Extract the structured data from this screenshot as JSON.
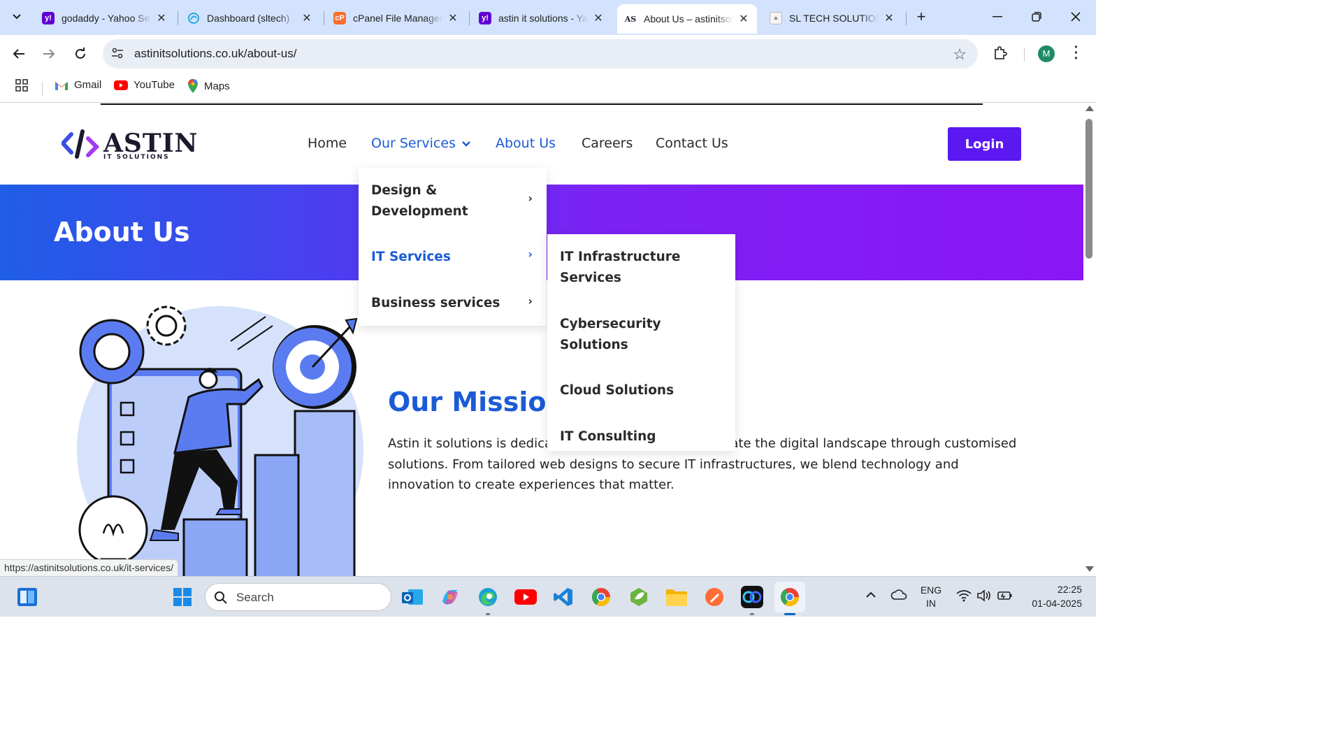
{
  "browser": {
    "tabs": [
      {
        "title": "godaddy - Yahoo Search",
        "favicon": "yahoo-icon",
        "color": "#6001d2",
        "glyph": "y!"
      },
      {
        "title": "Dashboard (sltech)",
        "favicon": "dashboard-icon",
        "color": "#29a8e0",
        "glyph": ""
      },
      {
        "title": "cPanel File Manager",
        "favicon": "cpanel-icon",
        "color": "#ff6c2c",
        "glyph": "cP"
      },
      {
        "title": "astin it solutions - Yahoo",
        "favicon": "yahoo-icon",
        "color": "#6001d2",
        "glyph": "y!"
      },
      {
        "title": "About Us – astinitsolutions",
        "favicon": "astin-icon",
        "color": "#1a1a2e",
        "glyph": "AS"
      },
      {
        "title": "SL TECH SOLUTIONS",
        "favicon": "sltech-icon",
        "color": "#888888",
        "glyph": ""
      }
    ],
    "active_tab": 4,
    "url": "astinitsolutions.co.uk/about-us/",
    "profile_initial": "M",
    "bookmarks": [
      {
        "label": "Gmail"
      },
      {
        "label": "YouTube"
      },
      {
        "label": "Maps"
      }
    ],
    "status_url": "https://astinitsolutions.co.uk/it-services/"
  },
  "site": {
    "logo": {
      "name": "ASTIN",
      "tagline": "IT SOLUTIONS"
    },
    "nav": {
      "home": "Home",
      "services": "Our Services",
      "about": "About Us",
      "careers": "Careers",
      "contact": "Contact Us"
    },
    "login": "Login",
    "hero_title": "About Us",
    "services_menu": [
      {
        "label": "Design & Development"
      },
      {
        "label": "IT Services"
      },
      {
        "label": "Business services"
      }
    ],
    "it_services_submenu": [
      {
        "label": "IT Infrastructure Services"
      },
      {
        "label": "Cybersecurity Solutions"
      },
      {
        "label": "Cloud Solutions"
      },
      {
        "label": "IT Consulting"
      }
    ],
    "mission": {
      "title": "Our Mission",
      "text_before": "Astin it solutions is dedica",
      "text_after": "gate the digital landscape through customised solutions. From tailored web designs to secure IT infrastructures, we blend technology and innovation to create experiences that matter."
    },
    "colors": {
      "brand_blue": "#1b5bd6",
      "login_purple": "#5b18f0"
    }
  },
  "taskbar": {
    "search_label": "Search",
    "lang_top": "ENG",
    "lang_bottom": "IN",
    "time": "22:25",
    "date": "01-04-2025",
    "apps": [
      "widgets-icon",
      "windows-start-icon",
      "outlook-icon",
      "copilot-icon",
      "edge-icon",
      "youtube-icon",
      "vscode-icon",
      "chrome-icon",
      "springboot-icon",
      "file-explorer-icon",
      "postman-icon",
      "webex-icon",
      "chrome-active-icon"
    ]
  }
}
